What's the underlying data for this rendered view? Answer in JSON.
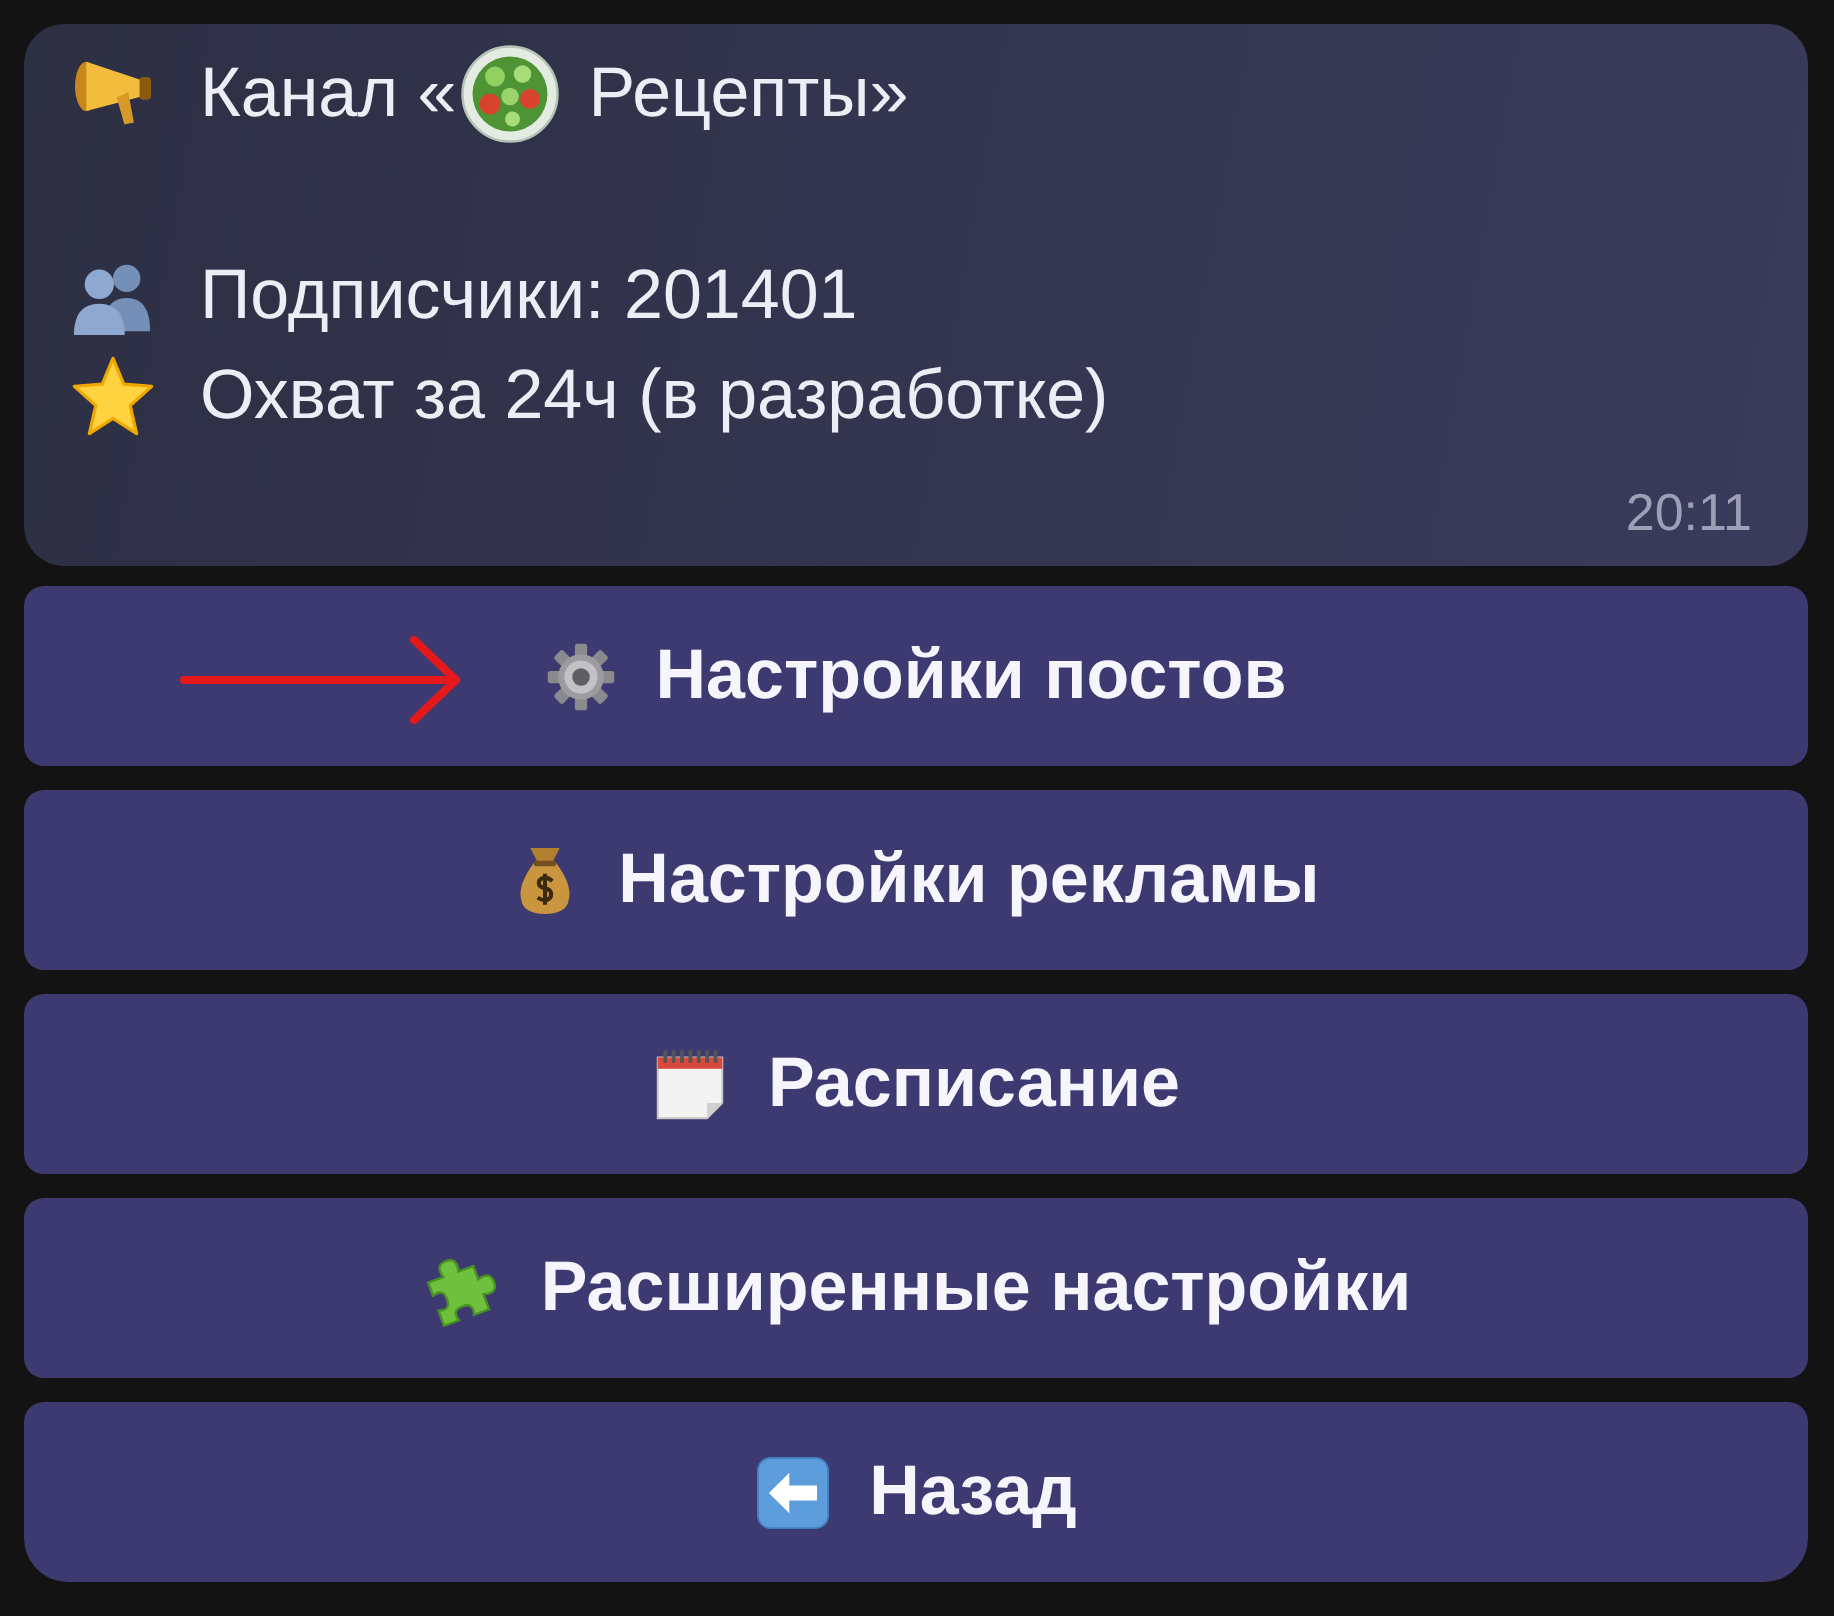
{
  "message": {
    "title": {
      "prefix": "Канал «",
      "channel_name": "Рецепты»"
    },
    "stats": [
      {
        "text": "Подписчики: 201401"
      },
      {
        "text": "Охват за 24ч (в разработке)"
      }
    ],
    "time": "20:11"
  },
  "buttons": [
    {
      "label": "Настройки постов",
      "pointed_at": true
    },
    {
      "label": "Настройки рекламы",
      "pointed_at": false
    },
    {
      "label": "Расписание",
      "pointed_at": false
    },
    {
      "label": "Расширенные настройки",
      "pointed_at": false
    },
    {
      "label": "Назад",
      "pointed_at": false
    }
  ]
}
